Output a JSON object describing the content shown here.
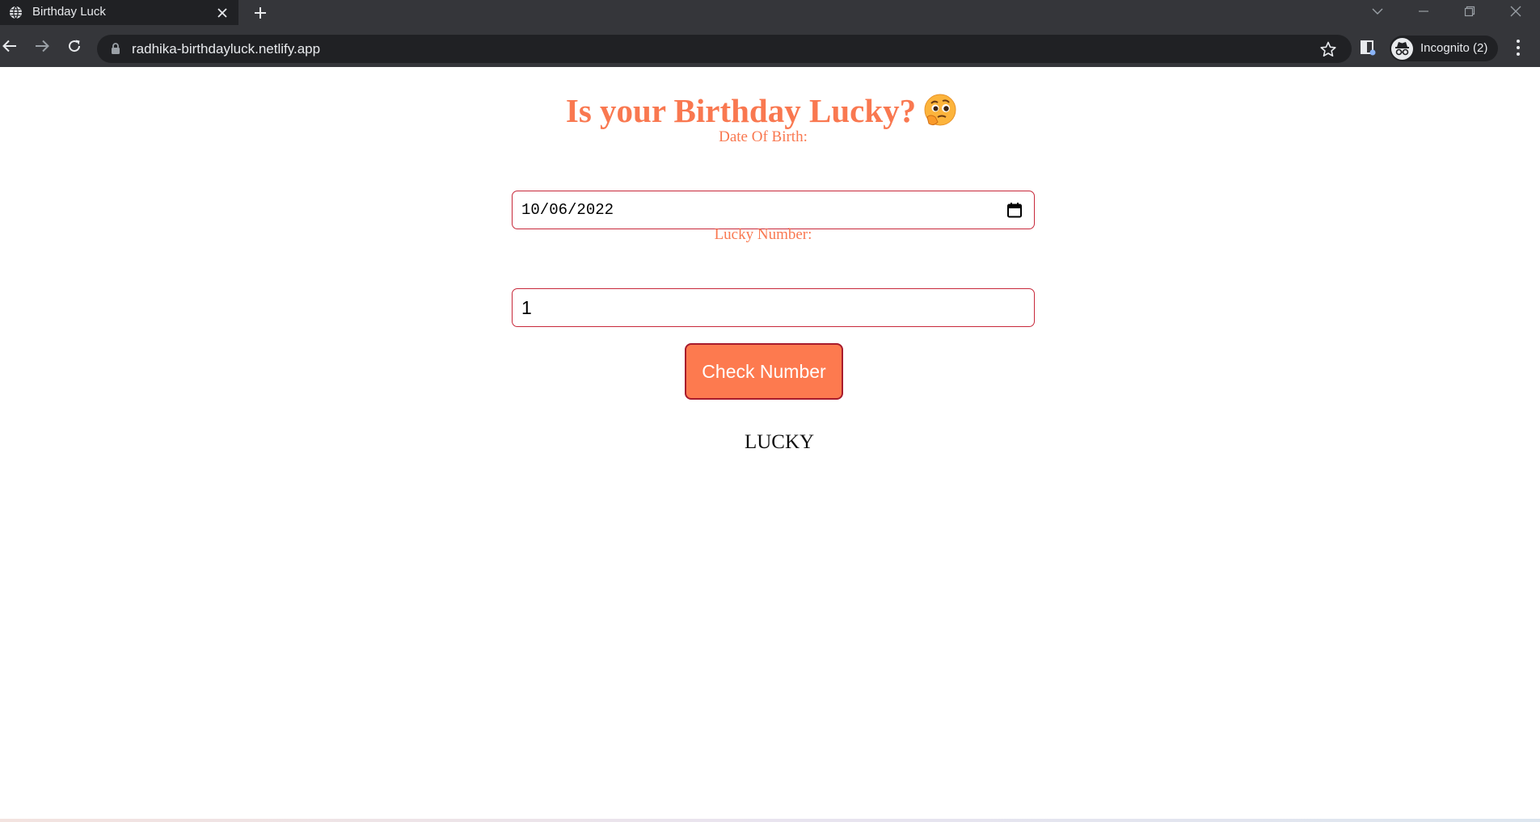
{
  "browser": {
    "tab_title": "Birthday Luck",
    "url": "radhika-birthdayluck.netlify.app",
    "incognito_label": "Incognito (2)",
    "icons": [
      "globe-icon",
      "close-icon",
      "plus-icon",
      "back-icon",
      "forward-icon",
      "reload-icon",
      "lock-icon",
      "star-icon",
      "extension-icon",
      "incognito-icon",
      "menu-icon",
      "minimize-icon",
      "restore-icon",
      "tab-search-icon"
    ]
  },
  "page": {
    "title": "Is your Birthday Lucky?",
    "emoji": "thinking-face-icon",
    "dob_label": "Date Of Birth:",
    "dob_value": "10/06/2022",
    "lucky_label": "Lucky Number:",
    "lucky_value": "1",
    "button_label": "Check Number",
    "result": "LUCKY"
  },
  "colors": {
    "accent": "#f97850",
    "button_bg": "#fd7a4f",
    "input_border": "#c7283a",
    "chrome_dark": "#35363a",
    "chrome_darker": "#202124"
  }
}
